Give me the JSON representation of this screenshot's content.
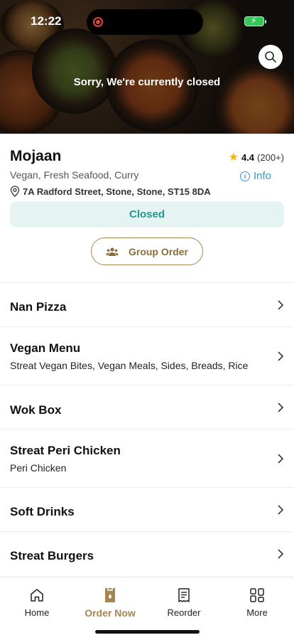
{
  "status_bar": {
    "time": "12:22"
  },
  "hero": {
    "closed_message": "Sorry, We're currently closed"
  },
  "restaurant": {
    "name": "Mojaan",
    "rating": "4.4",
    "rating_count": "(200+)",
    "cuisine": "Vegan, Fresh Seafood, Curry",
    "info_label": "Info",
    "address": "7A Radford Street, Stone, Stone, ST15 8DA",
    "status_label": "Closed",
    "group_order_label": "Group Order"
  },
  "menu": {
    "categories": [
      {
        "title": "Nan Pizza",
        "subtitle": ""
      },
      {
        "title": "Vegan Menu",
        "subtitle": "Streat Vegan Bites, Vegan Meals, Sides, Breads, Rice"
      },
      {
        "title": "Wok Box",
        "subtitle": ""
      },
      {
        "title": "Streat Peri Chicken",
        "subtitle": "Peri Chicken"
      },
      {
        "title": "Soft Drinks",
        "subtitle": ""
      },
      {
        "title": "Streat Burgers",
        "subtitle": ""
      }
    ]
  },
  "tabs": [
    {
      "label": "Home",
      "icon": "home-icon"
    },
    {
      "label": "Order Now",
      "icon": "order-bag-icon",
      "active": true
    },
    {
      "label": "Reorder",
      "icon": "receipt-icon"
    },
    {
      "label": "More",
      "icon": "grid-icon"
    }
  ],
  "colors": {
    "accent": "#a58552",
    "closed_bg": "#e5f3f2",
    "closed_text": "#1e9a8f",
    "info_link": "#3a97c4",
    "star": "#f2b705"
  }
}
